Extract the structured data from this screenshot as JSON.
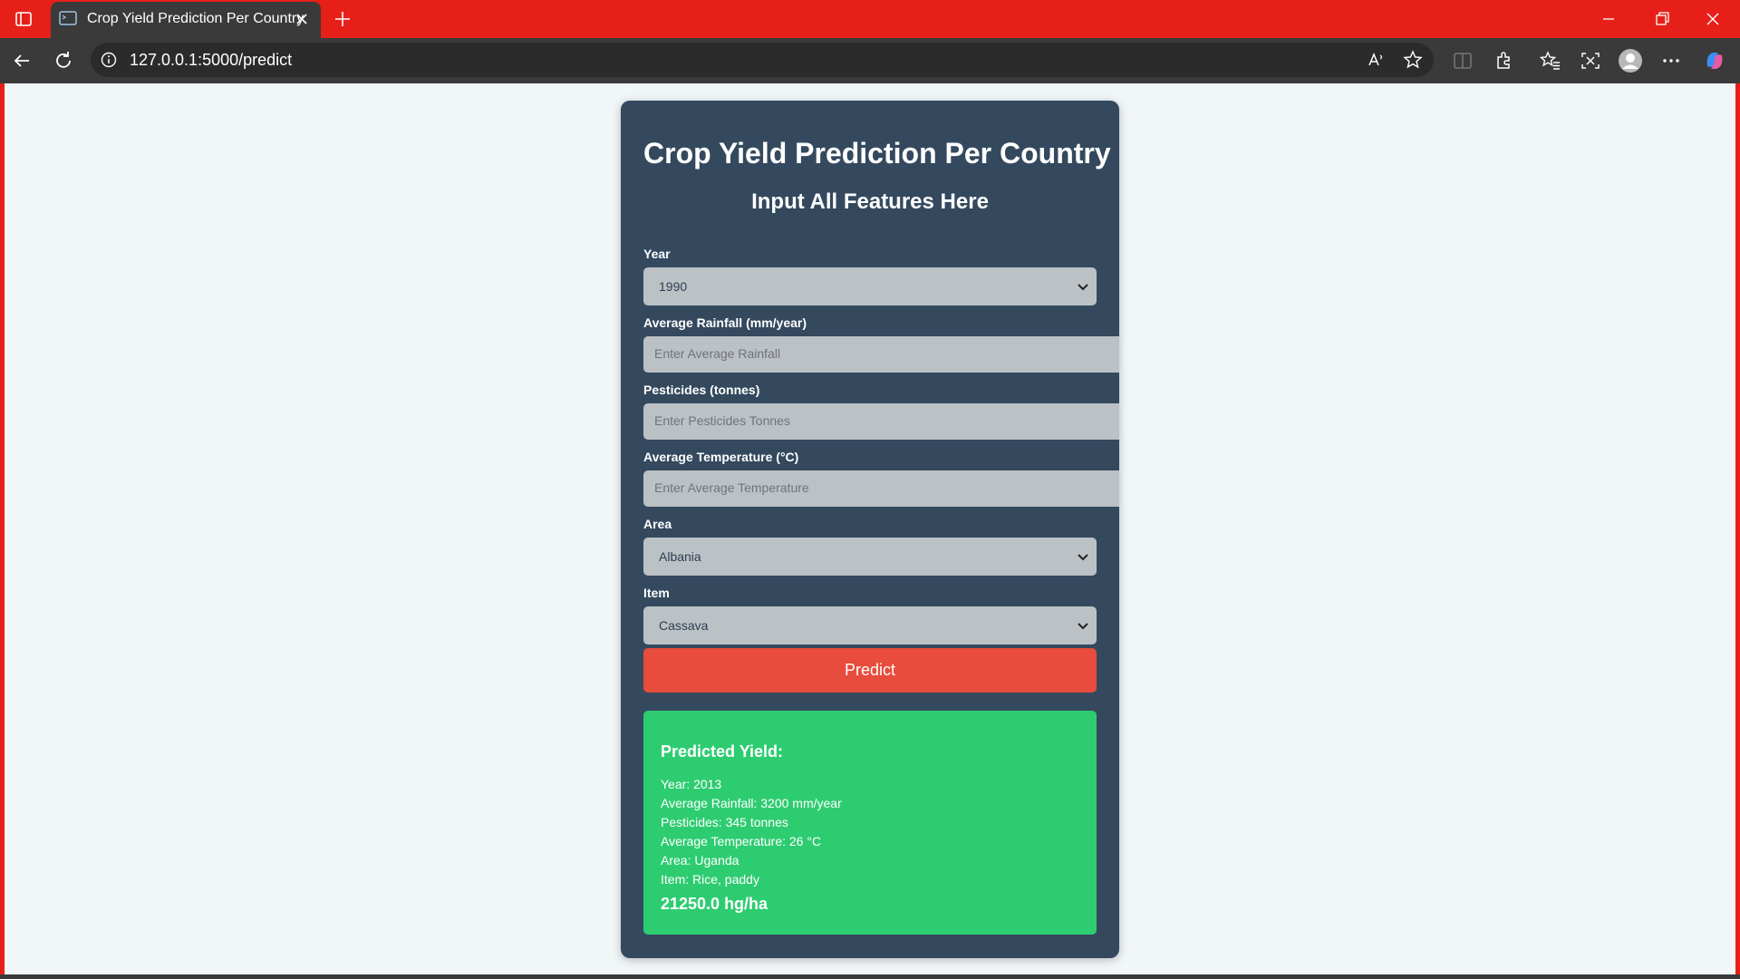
{
  "browser": {
    "tab_title": "Crop Yield Prediction Per Country",
    "url": "127.0.0.1:5000/predict"
  },
  "form": {
    "title": "Crop Yield Prediction Per Country",
    "subtitle": "Input All Features Here",
    "year": {
      "label": "Year",
      "value": "1990"
    },
    "rainfall": {
      "label": "Average Rainfall (mm/year)",
      "placeholder": "Enter Average Rainfall"
    },
    "pesticides": {
      "label": "Pesticides (tonnes)",
      "placeholder": "Enter Pesticides Tonnes"
    },
    "temperature": {
      "label": "Average Temperature (°C)",
      "placeholder": "Enter Average Temperature"
    },
    "area": {
      "label": "Area",
      "value": "Albania"
    },
    "item": {
      "label": "Item",
      "value": "Cassava"
    },
    "predict_label": "Predict"
  },
  "result": {
    "title": "Predicted Yield:",
    "year": "Year: 2013",
    "rainfall": "Average Rainfall: 3200 mm/year",
    "pesticides": "Pesticides: 345 tonnes",
    "temperature": "Average Temperature: 26 °C",
    "area": "Area: Uganda",
    "item": "Item: Rice, paddy",
    "yield": "21250.0 hg/ha"
  },
  "colors": {
    "chrome_accent": "#e62019",
    "card": "#34495e",
    "predict_button": "#e74c3c",
    "result_box": "#2ecc71"
  }
}
